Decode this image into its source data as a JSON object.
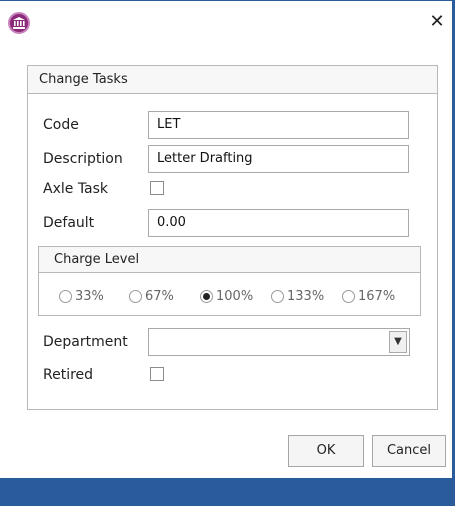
{
  "window": {
    "close_glyph": "✕",
    "app_icon": "institution-icon"
  },
  "group": {
    "title": "Change Tasks"
  },
  "fields": {
    "code_label": "Code",
    "code_value": "LET",
    "description_label": "Description",
    "description_value": "Letter Drafting",
    "axle_label": "Axle Task",
    "axle_checked": false,
    "default_label": "Default",
    "default_value": "0.00",
    "department_label": "Department",
    "department_value": "",
    "retired_label": "Retired",
    "retired_checked": false
  },
  "charge_level": {
    "title": "Charge Level",
    "options": [
      "33%",
      "67%",
      "100%",
      "133%",
      "167%"
    ],
    "selected": "100%"
  },
  "buttons": {
    "ok": "OK",
    "cancel": "Cancel"
  },
  "colors": {
    "accent": "#2a5b9a",
    "icon": "#8a2a78"
  }
}
